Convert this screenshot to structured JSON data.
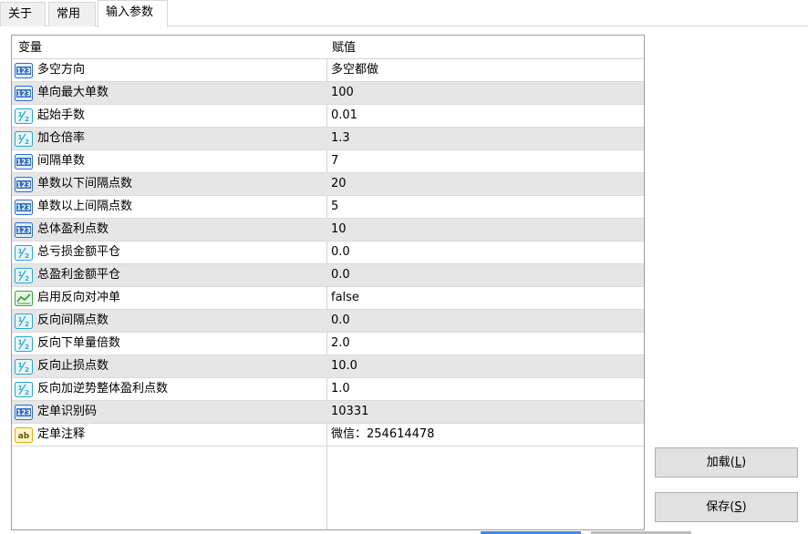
{
  "tabs": [
    {
      "label": "关于"
    },
    {
      "label": "常用"
    },
    {
      "label": "输入参数",
      "active": true
    }
  ],
  "grid": {
    "columns": [
      "变量",
      "赋值"
    ],
    "rows": [
      {
        "icon": "integer-icon",
        "name": "多空方向",
        "value": "多空都做"
      },
      {
        "icon": "integer-icon",
        "name": "单向最大单数",
        "value": "100"
      },
      {
        "icon": "double-icon",
        "name": "起始手数",
        "value": "0.01"
      },
      {
        "icon": "double-icon",
        "name": "加仓倍率",
        "value": "1.3"
      },
      {
        "icon": "integer-icon",
        "name": "间隔单数",
        "value": "7"
      },
      {
        "icon": "integer-icon",
        "name": "单数以下间隔点数",
        "value": "20"
      },
      {
        "icon": "integer-icon",
        "name": "单数以上间隔点数",
        "value": "5"
      },
      {
        "icon": "integer-icon",
        "name": "总体盈利点数",
        "value": "10"
      },
      {
        "icon": "double-icon",
        "name": "总亏损金额平仓",
        "value": "0.0"
      },
      {
        "icon": "double-icon",
        "name": "总盈利金额平仓",
        "value": "0.0"
      },
      {
        "icon": "bool-icon",
        "name": "启用反向对冲单",
        "value": "false"
      },
      {
        "icon": "double-icon",
        "name": "反向间隔点数",
        "value": "0.0"
      },
      {
        "icon": "double-icon",
        "name": "反向下单量倍数",
        "value": "2.0"
      },
      {
        "icon": "double-icon",
        "name": "反向止损点数",
        "value": "10.0"
      },
      {
        "icon": "double-icon",
        "name": "反向加逆势整体盈利点数",
        "value": "1.0"
      },
      {
        "icon": "integer-icon",
        "name": "定单识别码",
        "value": "10331"
      },
      {
        "icon": "string-icon",
        "name": "定单注释",
        "value": "微信：254614478"
      }
    ]
  },
  "buttons": {
    "load": {
      "label": "加载(",
      "key": "L",
      "end": ")"
    },
    "save": {
      "label": "保存(",
      "key": "S",
      "end": ")"
    }
  },
  "colors": {
    "integer_icon": "#2f6fc4",
    "double_icon": "#2aa7c9",
    "bool_icon": "#3aa53a",
    "string_icon": "#d9b300",
    "alt_row": "#e6e6e6"
  }
}
